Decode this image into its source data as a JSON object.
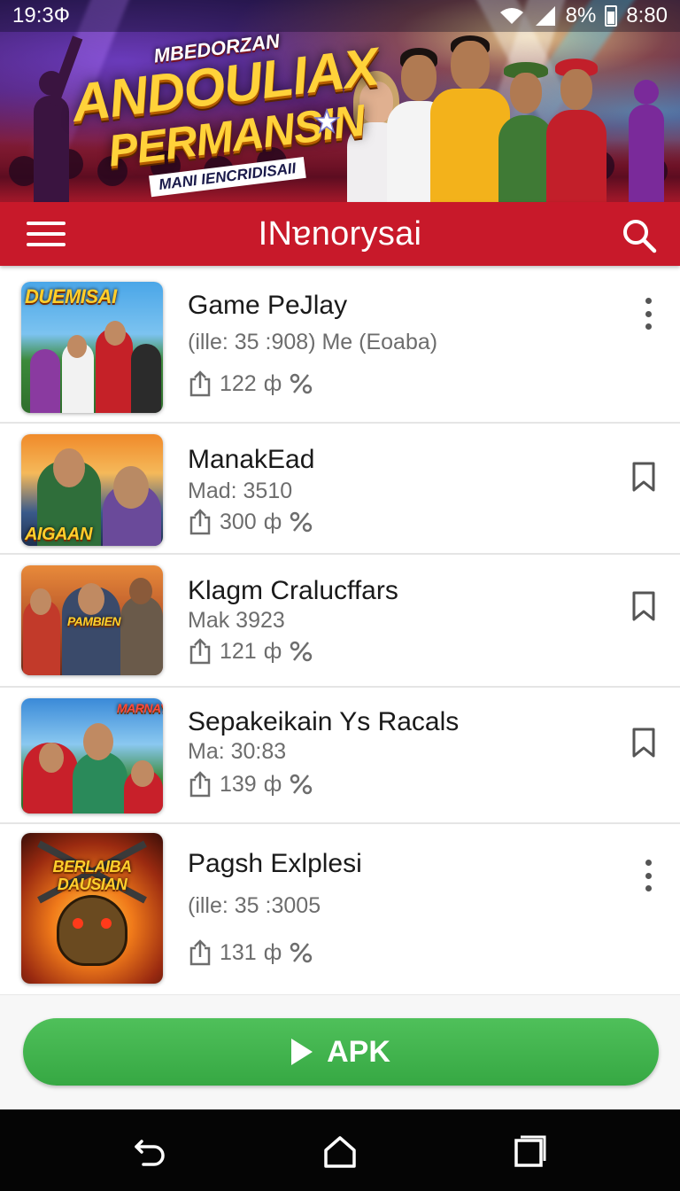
{
  "status_bar": {
    "time_left": "19:3Ф",
    "battery_percent": "8%",
    "time_right": "8:80",
    "icons": [
      "wifi-icon",
      "signal-icon",
      "battery-icon"
    ]
  },
  "hero": {
    "kicker": "MBEDORZAN",
    "title_line1": "ANDOULIAX",
    "title_line2": "PERMANSIN",
    "tagline": "MANI IENCRIDISAII"
  },
  "app_bar": {
    "title": "INɐnorysai",
    "menu_icon": "hamburger-menu-icon",
    "search_icon": "search-icon",
    "background": "#c8192a"
  },
  "games": [
    {
      "thumb_label": "DUEMISAI",
      "title": "Game PeJlay",
      "subtitle": "(ille: 35 :908) Me (Eoaba)",
      "count": "122",
      "stat_text": "ф",
      "action": "more-options-icon"
    },
    {
      "thumb_label": "AIGAAN",
      "title": "ManakEad",
      "subtitle": "Mad: 3510",
      "count": "300",
      "stat_text": "ф",
      "action": "bookmark-icon"
    },
    {
      "thumb_label": "PAMBIEN",
      "title": "Klagm Cralucffars",
      "subtitle": "Mak 3923",
      "count": "121",
      "stat_text": "ф",
      "action": "bookmark-icon"
    },
    {
      "thumb_label": "MARNAY",
      "title": "Sepakeikain Ys Racals",
      "subtitle": "Ma: 30:83",
      "count": "139",
      "stat_text": "ф",
      "action": "bookmark-icon"
    },
    {
      "thumb_label": "BERLAIBA DAUSIAN",
      "title": "Pagsh Exlplesi",
      "subtitle": "(ille: 35 :3005",
      "count": "131",
      "stat_text": "ф",
      "action": "more-options-icon"
    }
  ],
  "bottom": {
    "apk_label": "APK",
    "apk_color": "#3db54a"
  },
  "nav_bar": {
    "icons": [
      "back-icon",
      "home-icon",
      "recents-icon"
    ]
  }
}
